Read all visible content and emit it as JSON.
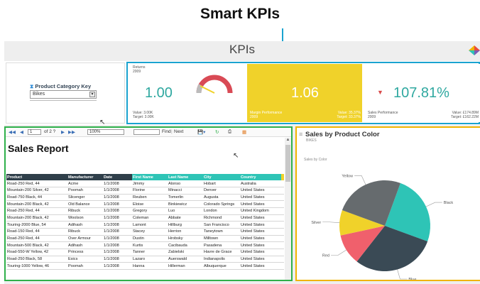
{
  "headline": "Smart KPIs",
  "dashboard": {
    "title": "KPIs"
  },
  "filter": {
    "label": "Product Category Key",
    "value": "Bikes"
  },
  "kpis": [
    {
      "name": "Returns",
      "sub": "2009",
      "value": "1.00",
      "footer_left_1": "Value: 3.00K",
      "footer_left_2": "Target: 3.00K",
      "gauge_level": 0.85
    },
    {
      "name": "Margin Performance",
      "sub": "2009",
      "value": "1.06",
      "footer_left_1": "Margin Performance",
      "footer_left_2": "2009",
      "footer_right_1": "Value: 35.37%",
      "footer_right_2": "Target: 33.37%",
      "color": "#f0d22a"
    },
    {
      "name": "Sales Performance",
      "sub": "2009",
      "value": "107.81%",
      "trend": "down",
      "footer_left_1": "Sales Performance",
      "footer_left_2": "2009",
      "footer_right_1": "Value: £174.89M",
      "footer_right_2": "Target: £162.22M"
    }
  ],
  "report_toolbar": {
    "page_current": "1",
    "page_of": "of 2 ?",
    "zoom": "100%",
    "find": "Find",
    "next": "Next"
  },
  "report": {
    "title": "Sales Report",
    "columns": [
      "Product",
      "Manufacturer",
      "Date",
      "First Name",
      "Last Name",
      "City",
      "Country"
    ],
    "rows": [
      [
        "Road-250 Red, 44",
        "Acme",
        "1/1/2008",
        "Jimmy",
        "Alonso",
        "Hobart",
        "Australia"
      ],
      [
        "Mountain-200 Silver, 42",
        "Poomah",
        "1/1/2008",
        "Florine",
        "Minacci",
        "Denver",
        "United States"
      ],
      [
        "Road-750 Black, 44",
        "Slicenger",
        "1/1/2008",
        "Reuben",
        "Tomerlin",
        "Augusta",
        "United States"
      ],
      [
        "Mountain-200 Black, 42",
        "Old Balance",
        "1/1/2008",
        "Eloise",
        "Binkiewicz",
        "Colorado Springs",
        "United States"
      ],
      [
        "Road-250 Red, 44",
        "Ribuck",
        "1/1/2008",
        "Gregory",
        "Luo",
        "London",
        "United Kingdom"
      ],
      [
        "Mountain-200 Black, 42",
        "Woolson",
        "1/1/2008",
        "Coleman",
        "Abbate",
        "Richmond",
        "United States"
      ],
      [
        "Touring-2000 Blue, 54",
        "Adihash",
        "1/1/2008",
        "Lamont",
        "Hillburg",
        "San Francisco",
        "United States"
      ],
      [
        "Road-150 Red, 44",
        "Ribuck",
        "1/1/2008",
        "Stacey",
        "Herrion",
        "Taneytown",
        "United States"
      ],
      [
        "Road-250 Red, 44",
        "Over Armour",
        "1/1/2008",
        "Dustin",
        "Hrobsky",
        "Milltown",
        "United States"
      ],
      [
        "Mountain-500 Black, 42",
        "Adihash",
        "1/1/2008",
        "Kurtis",
        "Cacibauda",
        "Pasadena",
        "United States"
      ],
      [
        "Road-550-W Yellow, 42",
        "Princess",
        "1/1/2008",
        "Tanner",
        "Zabielski",
        "Havre de Grace",
        "United States"
      ],
      [
        "Road-250 Black, 58",
        "Esics",
        "1/1/2008",
        "Lazaro",
        "Auerswald",
        "Indianapolis",
        "United States"
      ],
      [
        "Touring-1000 Yellow, 46",
        "Poomah",
        "1/1/2008",
        "Hanna",
        "Hillerman",
        "Albuquerque",
        "United States"
      ]
    ]
  },
  "chart_panel": {
    "title": "Sales by Product Color",
    "subtitle": "BIKES",
    "inner_title": "Sales by Color"
  },
  "chart_data": {
    "type": "pie",
    "title": "Sales by Color",
    "categories": [
      "Black",
      "Blue",
      "Red",
      "Silver",
      "Yellow"
    ],
    "values": [
      25,
      30,
      11,
      9,
      25
    ],
    "colors": [
      "#2ec4b6",
      "#3a4a55",
      "#f0606c",
      "#f0d22a",
      "#666b6e"
    ]
  }
}
